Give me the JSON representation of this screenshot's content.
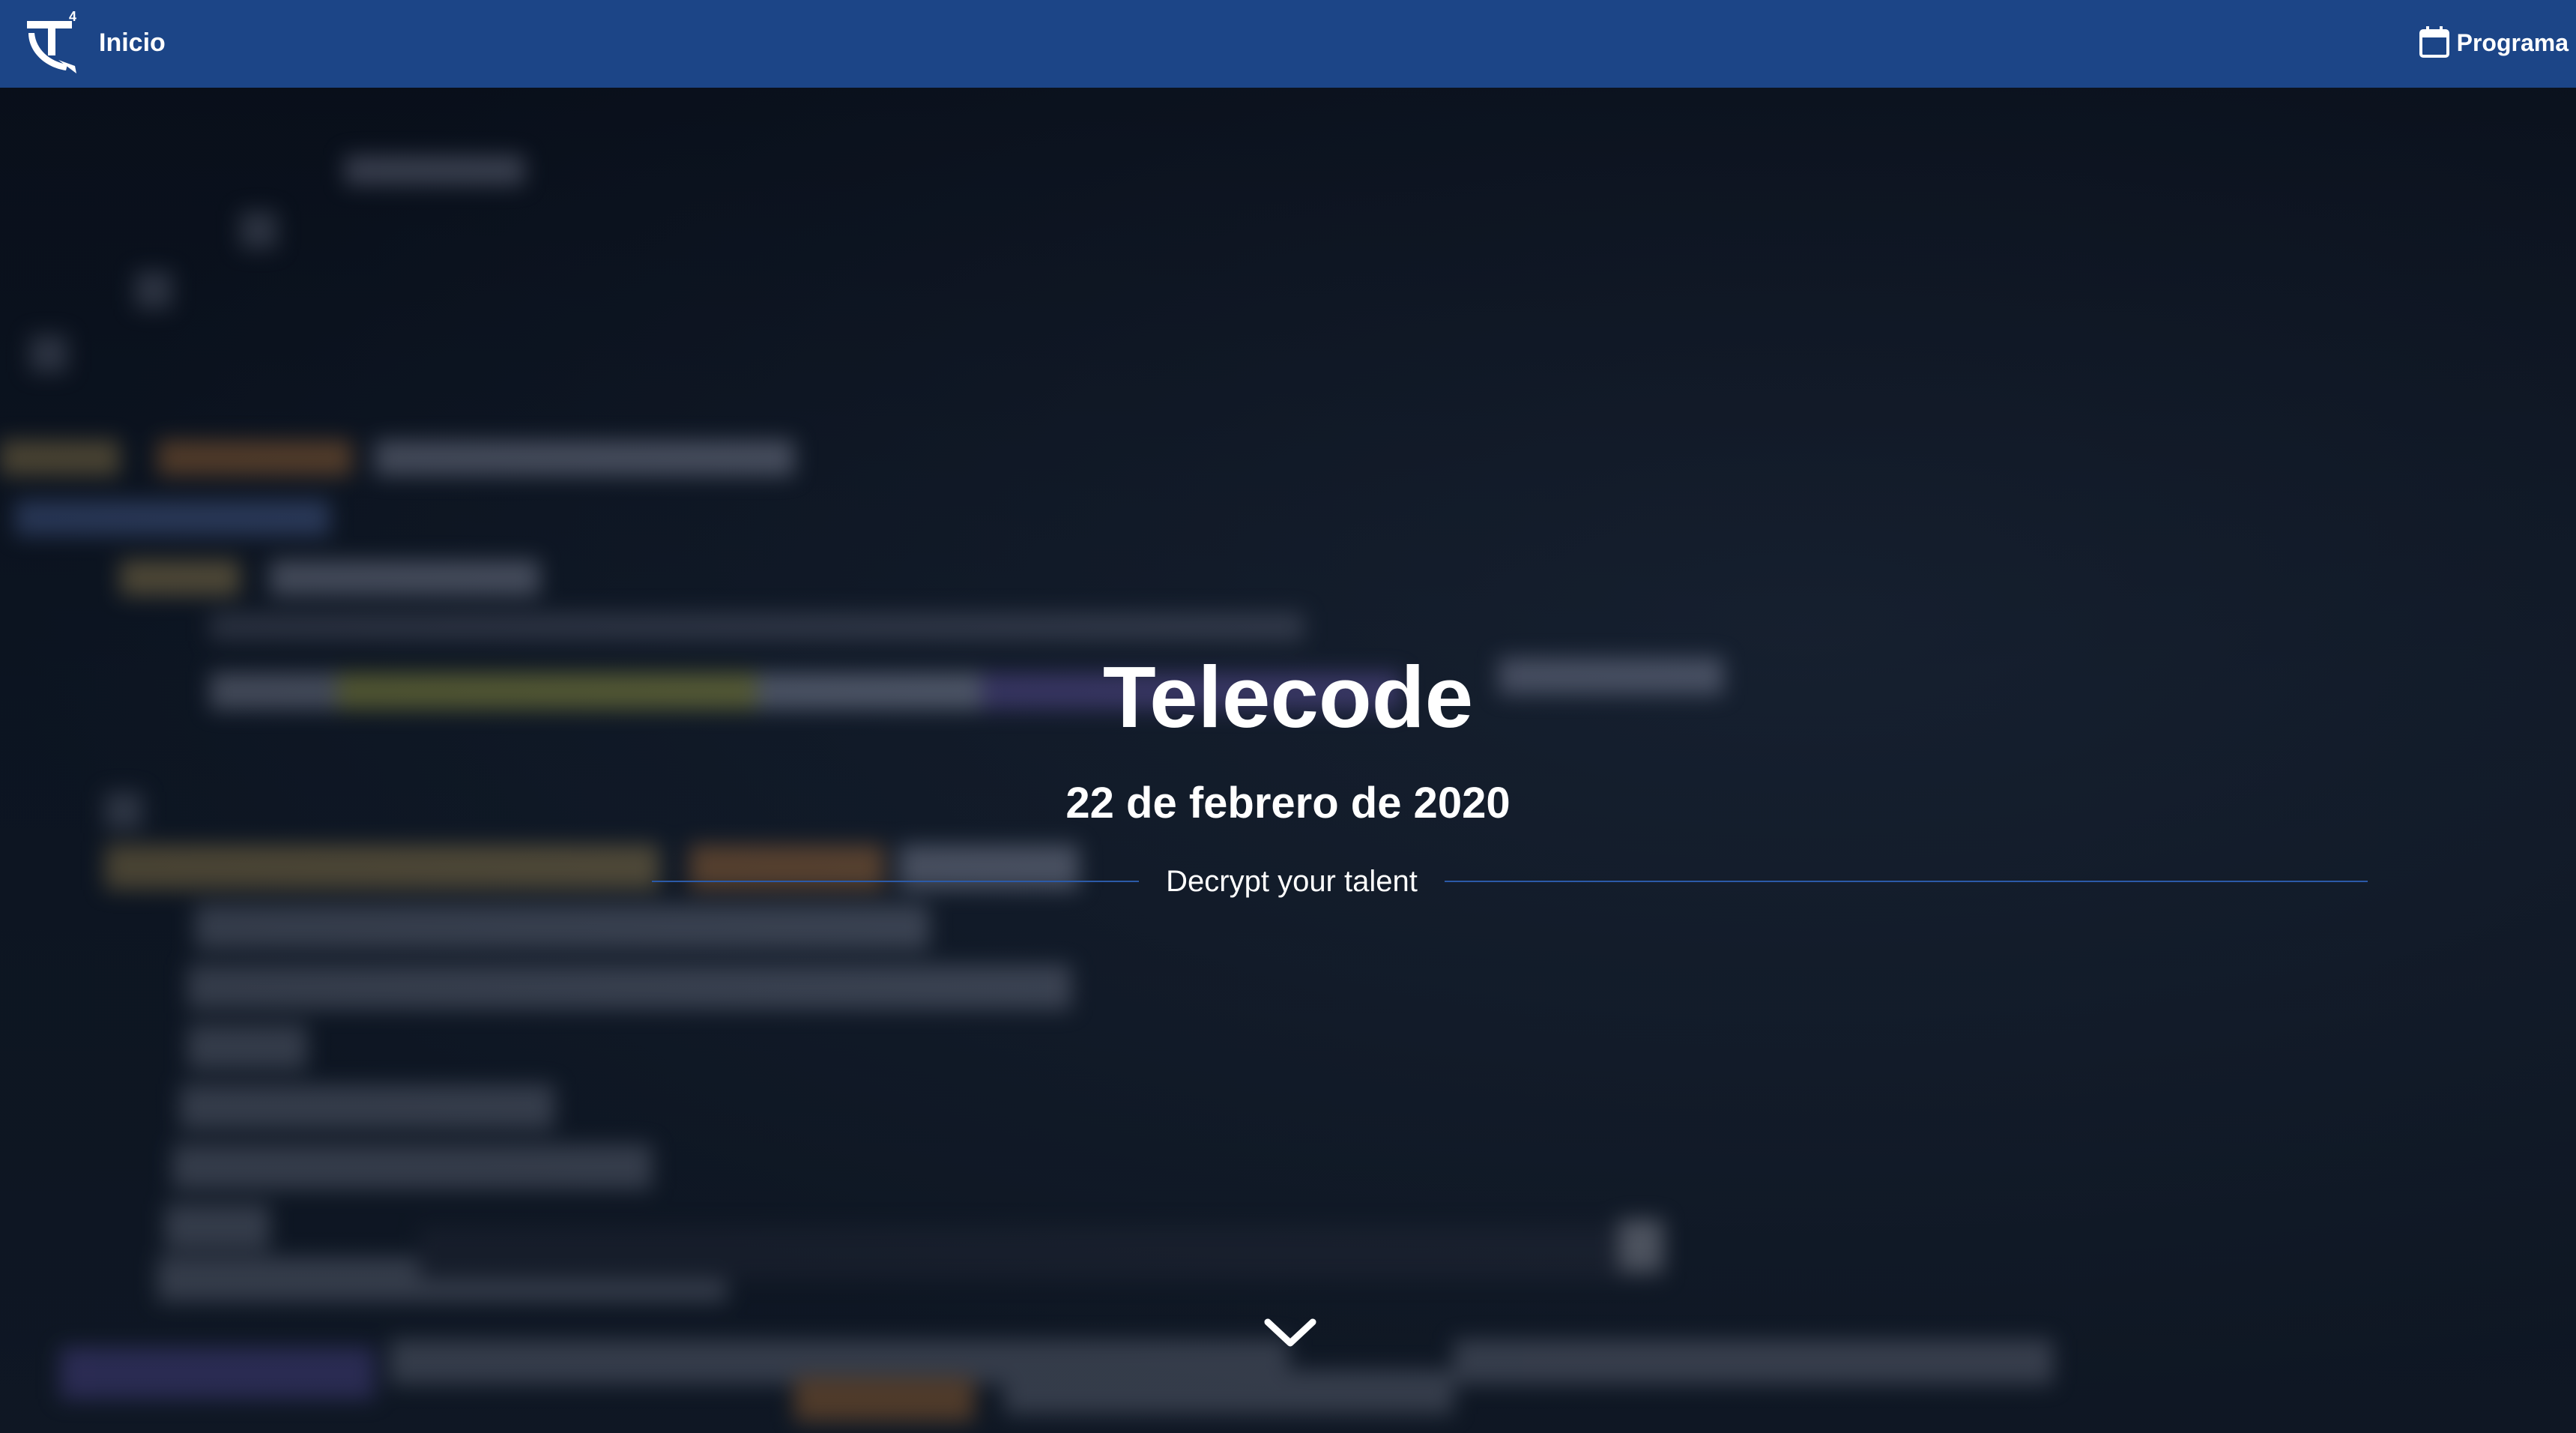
{
  "navbar": {
    "brand_label": "Inicio",
    "logo_icon": "telecode-logo-icon",
    "program_label": "Programa",
    "program_icon": "calendar-icon",
    "background_color": "#1c4587"
  },
  "hero": {
    "title": "Telecode",
    "date": "22 de febrero de 2020",
    "tagline": "Decrypt your talent",
    "scroll_icon": "chevron-down-icon",
    "accent_line_color": "#2b5aa8"
  }
}
